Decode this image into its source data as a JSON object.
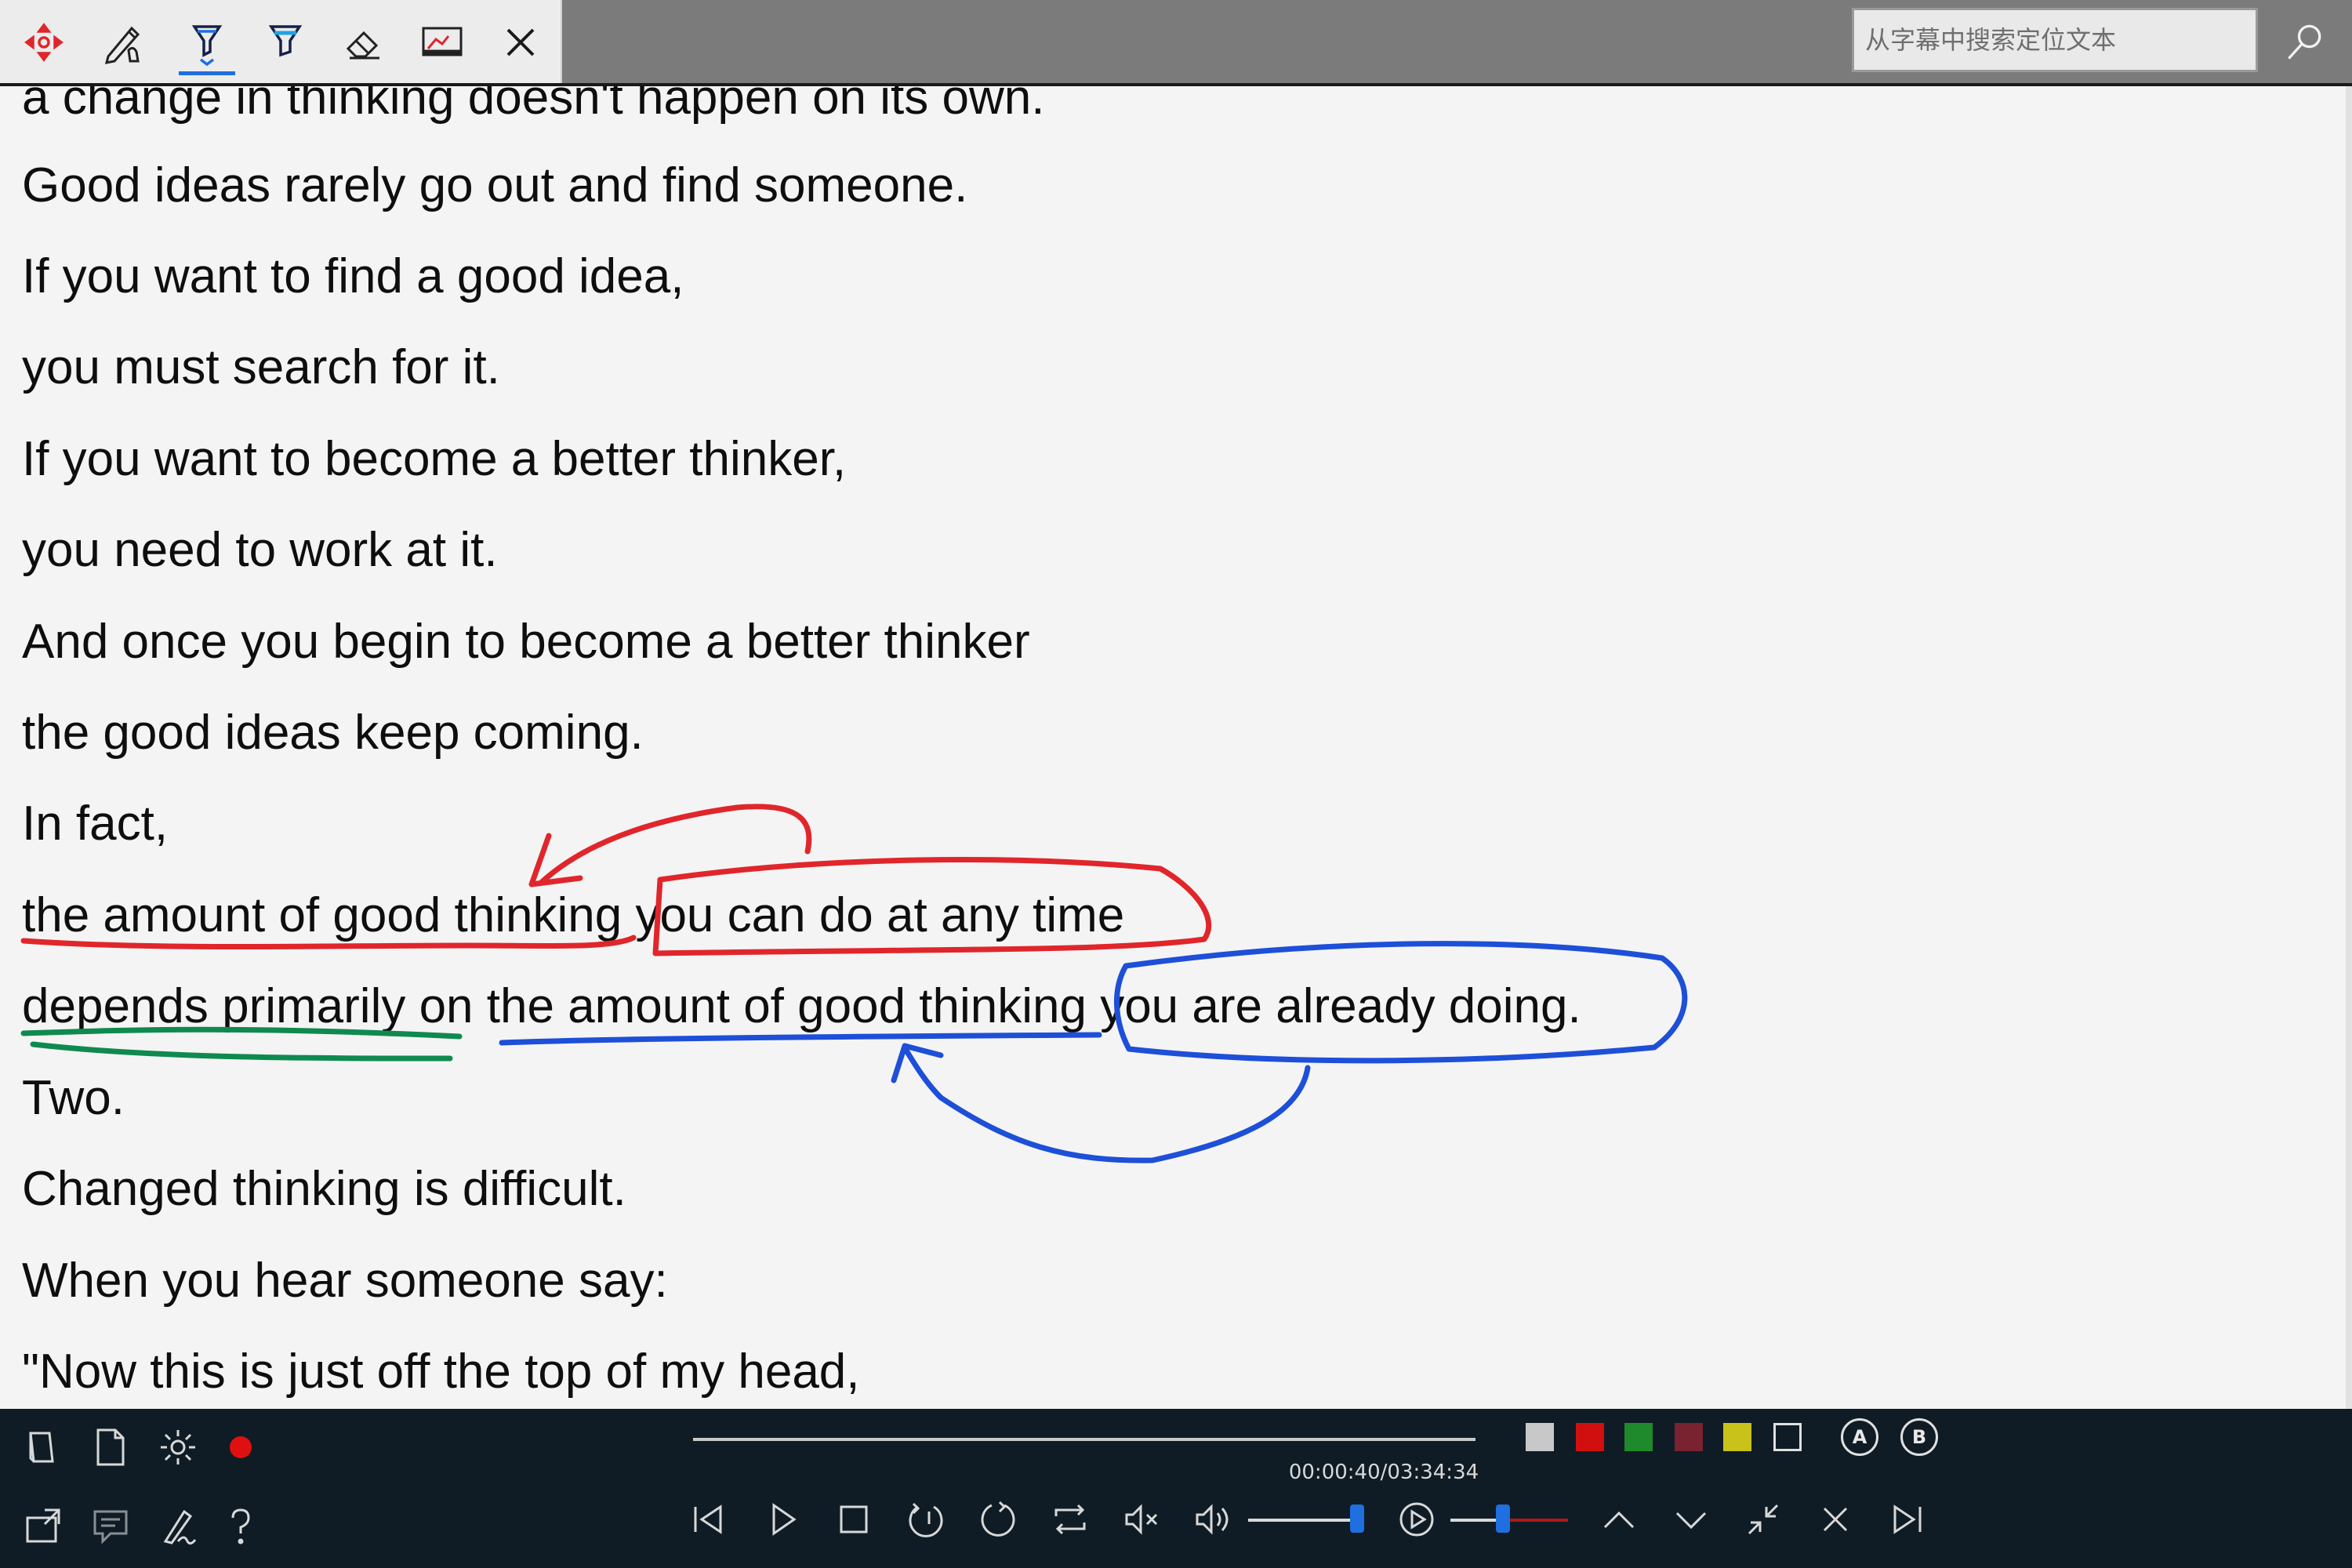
{
  "toolbar": {
    "tools": [
      {
        "name": "move",
        "icon": "move-target-icon"
      },
      {
        "name": "pen",
        "icon": "pen-cursor-icon"
      },
      {
        "name": "highlighter",
        "icon": "marker-icon",
        "active": true
      },
      {
        "name": "highlighter-alt",
        "icon": "marker-blue-icon"
      },
      {
        "name": "eraser",
        "icon": "eraser-icon"
      },
      {
        "name": "screenshot",
        "icon": "whiteboard-icon"
      },
      {
        "name": "close",
        "icon": "close-icon"
      }
    ]
  },
  "search": {
    "placeholder": "从字幕中搜索定位文本"
  },
  "transcript": {
    "lines": [
      "a change in thinking doesn't happen on its own.",
      "Good ideas rarely go out and find someone.",
      "If you want to find a good idea,",
      "you must search for it.",
      "If you want to become a better thinker,",
      "you need to work at it.",
      "And once you begin to become a better thinker",
      "the good ideas keep coming.",
      "In fact,",
      "the amount of good thinking you can do at any time",
      "depends primarily on the amount of good thinking you are already doing.",
      "Two.",
      "Changed thinking is difficult.",
      "When you hear someone say:",
      "\"Now this is just off the top of my head,"
    ]
  },
  "ink_colors": {
    "red": "#e0262b",
    "blue": "#1d4fd8",
    "green": "#0f8a4f"
  },
  "player": {
    "time": "00:00:40/03:34:34",
    "progress": 0.003,
    "volume_level": 0.95,
    "speed_level": 0.45,
    "swatches": [
      "#c8c8c8",
      "#d20f0f",
      "#1f8a2b",
      "#7a2330",
      "#c8c21a",
      "#0f1c25"
    ],
    "ab_labels": [
      "A",
      "B"
    ],
    "left_icons": [
      "book-icon",
      "document-icon",
      "settings-icon",
      "record-icon",
      "popout-icon",
      "subtitle-icon",
      "signature-icon",
      "help-icon"
    ],
    "controls": [
      "previous-icon",
      "play-icon",
      "stop-icon",
      "replay-one-icon",
      "loop-icon",
      "repeat-icon",
      "mute-icon",
      "volume-icon",
      "speed-icon",
      "scroll-up-icon",
      "scroll-down-icon",
      "shrink-icon",
      "close-icon",
      "next-icon"
    ]
  }
}
